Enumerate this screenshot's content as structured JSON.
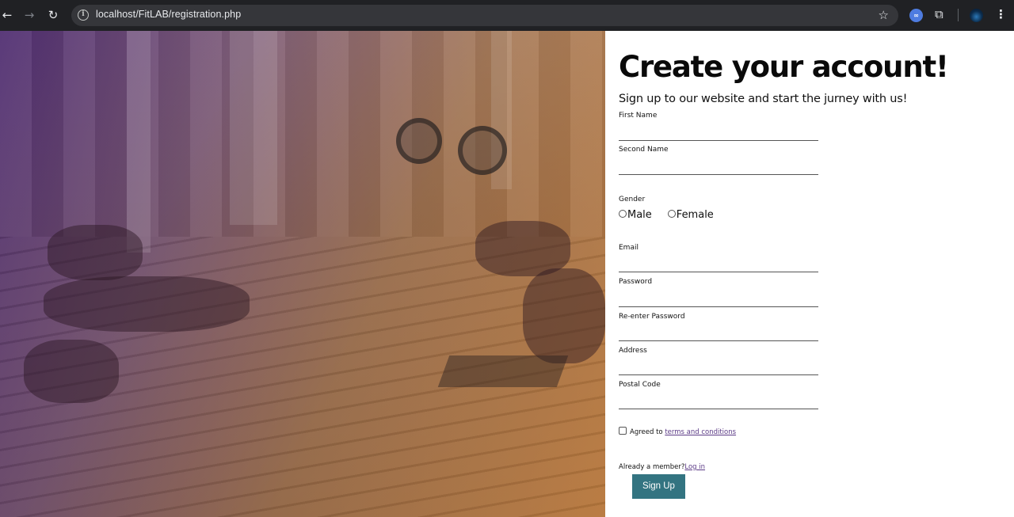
{
  "browser": {
    "url": "localhost/FitLAB/registration.php",
    "back_glyph": "←",
    "forward_glyph": "→",
    "reload_glyph": "↻",
    "star_glyph": "☆",
    "menu_glyph": "⋮",
    "extension_glyph": "∞",
    "puzzle_glyph": "⧉",
    "info_glyph": "i"
  },
  "form": {
    "title": "Create your account!",
    "subtitle": "Sign up to our website and start the jurney with us!",
    "fields": {
      "first_name_label": "First Name",
      "second_name_label": "Second Name",
      "gender_label": "Gender",
      "gender_options": [
        "Male",
        "Female"
      ],
      "email_label": "Email",
      "password_label": "Password",
      "reenter_password_label": "Re-enter Password",
      "address_label": "Address",
      "postal_code_label": "Postal Code"
    },
    "agree_text": "Agreed to",
    "terms_link": "terms and conditions",
    "member_text": "Already a member?",
    "login_link": "Log in",
    "submit_label": "Sign Up"
  },
  "colors": {
    "button_bg": "#337481",
    "link": "#5b3a86",
    "gradient_start": "#461e6e",
    "gradient_end": "#d78232"
  }
}
